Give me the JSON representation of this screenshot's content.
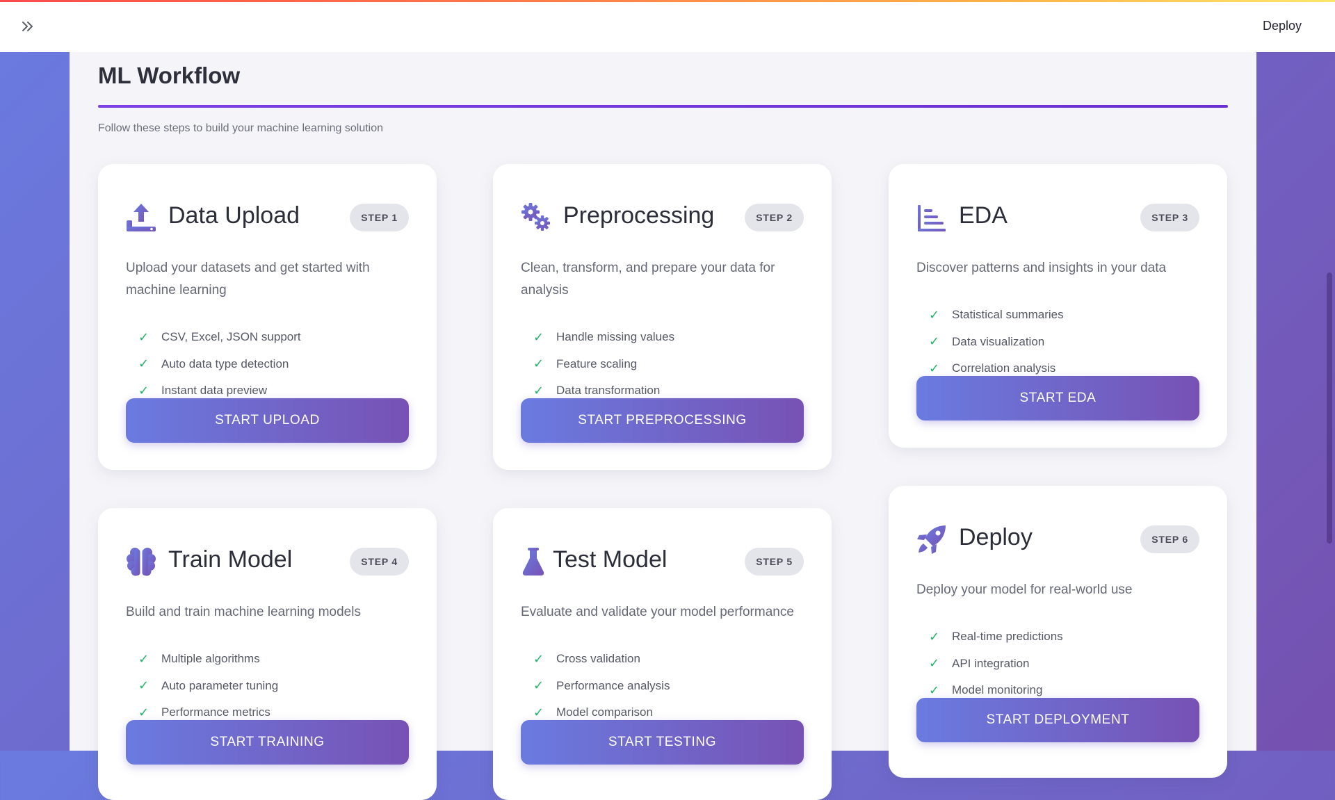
{
  "header": {
    "deploy_label": "Deploy",
    "expand_icon": "double-chevron-right-icon"
  },
  "page": {
    "title": "ML Workflow",
    "subtitle": "Follow these steps to build your machine learning solution"
  },
  "colors": {
    "accent_gradient_start": "#6a7be0",
    "accent_gradient_end": "#7752b4",
    "check_green": "#21b36b",
    "title_rule": "#7b3fe4"
  },
  "cards": [
    {
      "icon": "upload-icon",
      "title": "Data Upload",
      "step": "STEP 1",
      "description": "Upload your datasets and get started with machine learning",
      "features": [
        "CSV, Excel, JSON support",
        "Auto data type detection",
        "Instant data preview"
      ],
      "button": "START UPLOAD"
    },
    {
      "icon": "gears-icon",
      "title": "Preprocessing",
      "step": "STEP 2",
      "description": "Clean, transform, and prepare your data for analysis",
      "features": [
        "Handle missing values",
        "Feature scaling",
        "Data transformation"
      ],
      "button": "START PREPROCESSING"
    },
    {
      "icon": "bar-chart-icon",
      "title": "EDA",
      "step": "STEP 3",
      "description": "Discover patterns and insights in your data",
      "features": [
        "Statistical summaries",
        "Data visualization",
        "Correlation analysis"
      ],
      "button": "START EDA"
    },
    {
      "icon": "brain-icon",
      "title": "Train Model",
      "step": "STEP 4",
      "description": "Build and train machine learning models",
      "features": [
        "Multiple algorithms",
        "Auto parameter tuning",
        "Performance metrics"
      ],
      "button": "START TRAINING"
    },
    {
      "icon": "flask-icon",
      "title": "Test Model",
      "step": "STEP 5",
      "description": "Evaluate and validate your model performance",
      "features": [
        "Cross validation",
        "Performance analysis",
        "Model comparison"
      ],
      "button": "START TESTING"
    },
    {
      "icon": "rocket-icon",
      "title": "Deploy",
      "step": "STEP 6",
      "description": "Deploy your model for real-world use",
      "features": [
        "Real-time predictions",
        "API integration",
        "Model monitoring"
      ],
      "button": "START DEPLOYMENT"
    }
  ]
}
